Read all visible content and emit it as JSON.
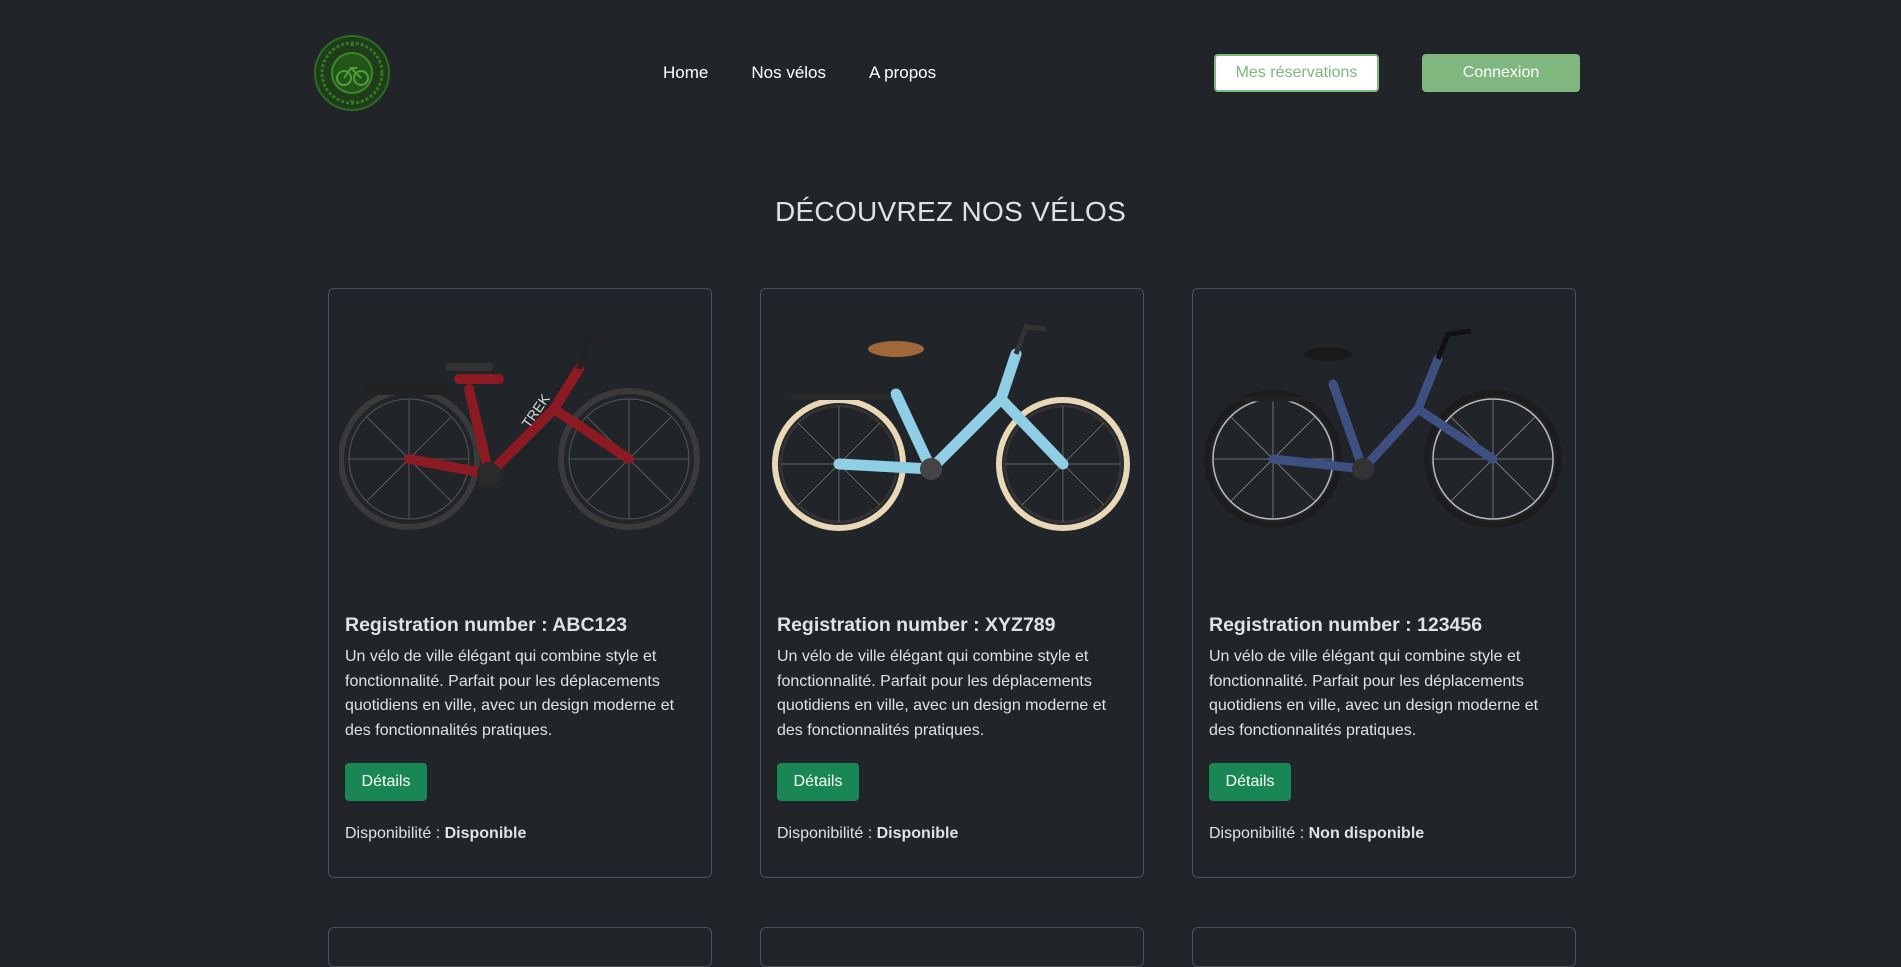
{
  "nav": {
    "links": [
      "Home",
      "Nos vélos",
      "A propos"
    ],
    "reservations_label": "Mes réservations",
    "login_label": "Connexion",
    "logo_icon": "bike-emblem-logo"
  },
  "page": {
    "title": "DÉCOUVREZ NOS VÉLOS"
  },
  "bikes": [
    {
      "title": "Registration number : ABC123",
      "description": "Un vélo de ville élégant qui combine style et fonctionnalité. Parfait pour les déplacements quotidiens en ville, avec un design moderne et des fonctionnalités pratiques.",
      "details_label": "Détails",
      "availability_label": "Disponibilité :",
      "availability_value": "Disponible",
      "frame_color": "#8b1a22",
      "image_icon": "red-city-ebike-image"
    },
    {
      "title": "Registration number : XYZ789",
      "description": "Un vélo de ville élégant qui combine style et fonctionnalité. Parfait pour les déplacements quotidiens en ville, avec un design moderne et des fonctionnalités pratiques.",
      "details_label": "Détails",
      "availability_label": "Disponibilité :",
      "availability_value": "Disponible",
      "frame_color": "#8fcfe6",
      "image_icon": "light-blue-city-ebike-image"
    },
    {
      "title": "Registration number : 123456",
      "description": "Un vélo de ville élégant qui combine style et fonctionnalité. Parfait pour les déplacements quotidiens en ville, avec un design moderne et des fonctionnalités pratiques.",
      "details_label": "Détails",
      "availability_label": "Disponibilité :",
      "availability_value": "Non disponible",
      "frame_color": "#3e4f82",
      "image_icon": "navy-city-bike-image"
    }
  ],
  "colors": {
    "background": "#212529",
    "accent_green": "#7fb77e",
    "details_button": "#198754",
    "card_border": "#495057"
  }
}
